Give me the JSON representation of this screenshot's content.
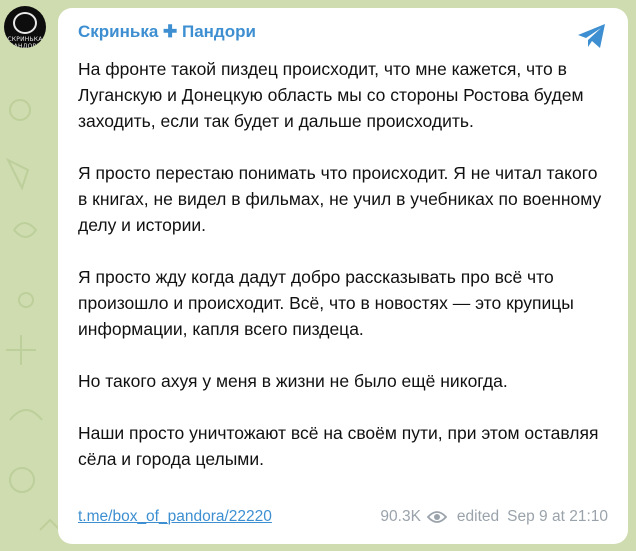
{
  "channel": {
    "name": "Скринька ✚ Пандори",
    "avatar_text": "СКРИНЬКА ПАНДОРИ"
  },
  "message": {
    "paragraphs": [
      "На фронте такой пиздец происходит, что мне кажется, что в Луганскую и Донецкую область мы со стороны Ростова будем заходить, если так будет и дальше происходить.",
      "Я просто перестаю понимать что происходит. Я не читал такого в книгах, не видел в фильмах, не учил в учебниках по военному делу и истории.",
      "Я просто жду когда дадут добро рассказывать про всё что произошло и происходит. Всё, что в новостях — это крупицы информации, капля всего пиздеца.",
      "Но такого ахуя у меня в жизни не было ещё никогда.",
      "Наши просто уничтожают всё на своём пути, при этом оставляя сёла и города целыми."
    ],
    "link": "t.me/box_of_pandora/22220",
    "views": "90.3K",
    "edited_label": "edited",
    "timestamp": "Sep 9 at 21:10"
  },
  "colors": {
    "accent": "#3d8fd1",
    "background": "#cfdcb0",
    "bubble": "#ffffff",
    "meta": "#9aa3ab"
  },
  "icons": {
    "platform": "telegram-icon",
    "views": "eye-icon"
  }
}
